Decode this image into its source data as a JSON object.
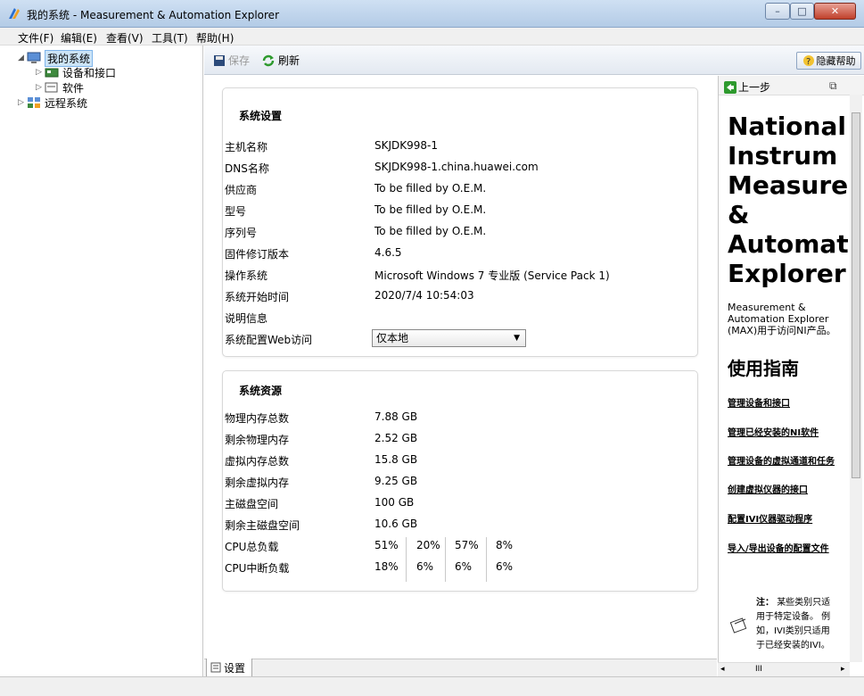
{
  "window": {
    "title": "我的系统 - Measurement & Automation Explorer",
    "controls": {
      "minimize": "–",
      "maximize": "□",
      "close": "✕"
    }
  },
  "menu": [
    "文件(F)",
    "编辑(E)",
    "查看(V)",
    "工具(T)",
    "帮助(H)"
  ],
  "tree": {
    "items": [
      {
        "label": "我的系统",
        "icon": "computer-icon",
        "expanded": true,
        "selected": true
      },
      {
        "label": "设备和接口",
        "icon": "devices-icon"
      },
      {
        "label": "软件",
        "icon": "software-icon"
      },
      {
        "label": "远程系统",
        "icon": "network-icon"
      }
    ]
  },
  "toolbar": {
    "save_label": "保存",
    "refresh_label": "刷新",
    "hide_help_label": "隐藏帮助"
  },
  "system_settings": {
    "title": "系统设置",
    "rows": [
      {
        "label": "主机名称",
        "value": "SKJDK998-1"
      },
      {
        "label": "DNS名称",
        "value": "SKJDK998-1.china.huawei.com"
      },
      {
        "label": "供应商",
        "value": "To be filled by O.E.M."
      },
      {
        "label": "型号",
        "value": "To be filled by O.E.M."
      },
      {
        "label": "序列号",
        "value": "To be filled by O.E.M."
      },
      {
        "label": "固件修订版本",
        "value": "4.6.5"
      },
      {
        "label": "操作系统",
        "value": "Microsoft Windows 7 专业版 (Service Pack 1)"
      },
      {
        "label": "系统开始时间",
        "value": "2020/7/4 10:54:03"
      },
      {
        "label": "说明信息",
        "value": ""
      }
    ],
    "web_access_label": "系统配置Web访问",
    "web_access_value": "仅本地"
  },
  "system_resources": {
    "title": "系统资源",
    "rows": [
      {
        "label": "物理内存总数",
        "value": "7.88 GB"
      },
      {
        "label": "剩余物理内存",
        "value": "2.52 GB"
      },
      {
        "label": "虚拟内存总数",
        "value": "15.8 GB"
      },
      {
        "label": "剩余虚拟内存",
        "value": "9.25 GB"
      },
      {
        "label": "主磁盘空间",
        "value": "100 GB"
      },
      {
        "label": "剩余主磁盘空间",
        "value": "10.6 GB"
      }
    ],
    "cpu_total_label": "CPU总负载",
    "cpu_total": [
      "51%",
      "20%",
      "57%",
      "8%"
    ],
    "cpu_interrupt_label": "CPU中断负载",
    "cpu_interrupt": [
      "18%",
      "6%",
      "6%",
      "6%"
    ]
  },
  "bottom_tab": {
    "label": "设置"
  },
  "help": {
    "back_label": "上一步",
    "big_title": "National\nInstrum\nMeasure\n&\nAutomat\nExplorer",
    "description": "Measurement &\nAutomation Explorer\n(MAX)用于访问NI产品。",
    "guide_title": "使用指南",
    "links": [
      "管理设备和接口",
      "管理已经安装的NI软件",
      "管理设备的虚拟通道和任务",
      "创建虚拟仪器的接口",
      "配置IVI仪器驱动程序",
      "导入/导出设备的配置文件"
    ],
    "note_label": "注：",
    "note_lines": [
      "某些类别只适",
      "用于特定设备。 例",
      "如，IVI类别只适用",
      "于已经安装的IVI。"
    ],
    "hscroll_label": "III"
  }
}
